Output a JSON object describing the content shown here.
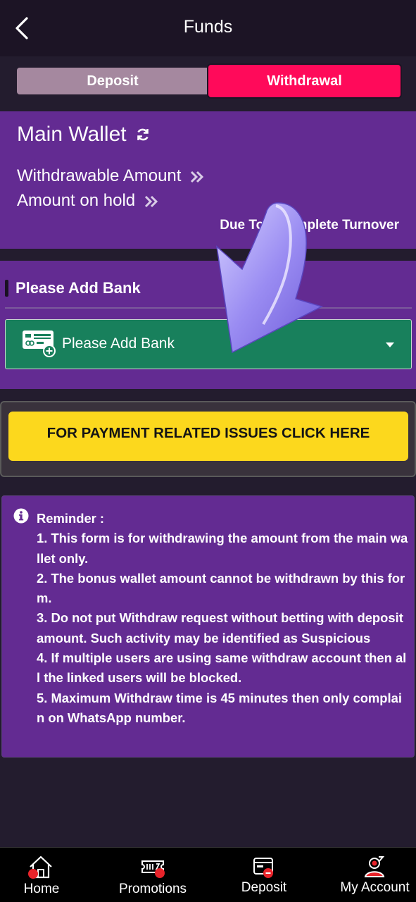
{
  "header": {
    "title": "Funds",
    "back_icon": "chevron-left-icon"
  },
  "tabs": {
    "deposit": "Deposit",
    "withdrawal": "Withdrawal"
  },
  "wallet": {
    "title": "Main Wallet",
    "withdrawable_label": "Withdrawable Amount",
    "hold_label": "Amount on hold",
    "turnover_note": "Due To Incomplete Turnover"
  },
  "bank": {
    "section_title": "Please Add Bank",
    "select_placeholder": "Please Add Bank"
  },
  "payment_issue_button": "FOR PAYMENT RELATED ISSUES CLICK HERE",
  "reminder": {
    "title": "Reminder :",
    "lines": [
      "1. This form is for withdrawing the amount from the main wallet only.",
      "2. The bonus wallet amount cannot be withdrawn by this form.",
      "3. Do not put Withdraw request without betting with deposit amount. Such activity may be identified as Suspicious",
      "4. If multiple users are using same withdraw account then all the linked users will be blocked.",
      "5. Maximum Withdraw time is 45 minutes then only complain on WhatsApp number."
    ]
  },
  "nav": {
    "home": "Home",
    "promotions": "Promotions",
    "deposit": "Deposit",
    "account": "My Account"
  },
  "colors": {
    "background": "#231c2e",
    "card_purple": "#632b92",
    "active_tab": "#ff0a5a",
    "inactive_tab": "#a5889f",
    "bank_select": "#18805c",
    "payment_button": "#fcd81d",
    "badge_red": "#e8232a"
  }
}
